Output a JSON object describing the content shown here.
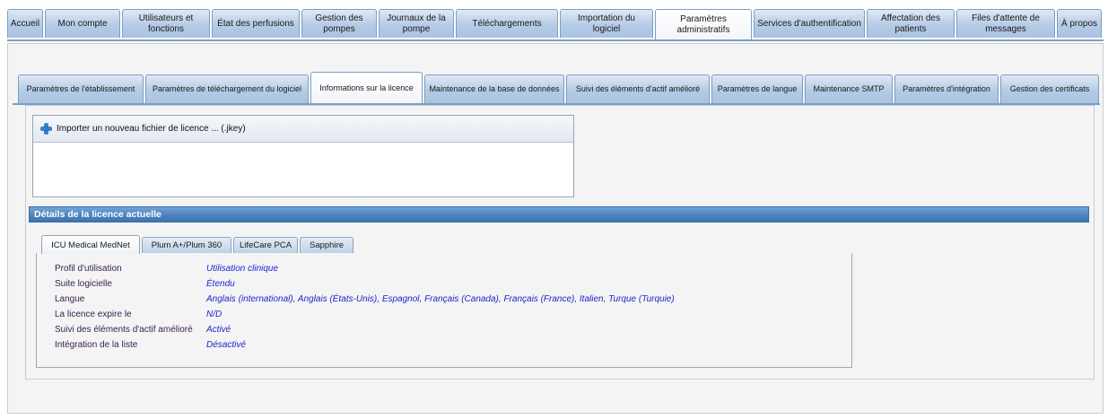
{
  "main_nav": {
    "tabs": [
      {
        "label": "Accueil"
      },
      {
        "label": "Mon compte"
      },
      {
        "label": "Utilisateurs et fonctions"
      },
      {
        "label": "État des perfusions"
      },
      {
        "label": "Gestion des pompes"
      },
      {
        "label": "Journaux de la pompe"
      },
      {
        "label": "Téléchargements"
      },
      {
        "label": "Importation du logiciel"
      },
      {
        "label": "Paramètres administratifs",
        "active": true
      },
      {
        "label": "Services d'authentification"
      },
      {
        "label": "Affectation des patients"
      },
      {
        "label": "Files d'attente de messages"
      },
      {
        "label": "À propos"
      }
    ]
  },
  "sub_nav": {
    "tabs": [
      {
        "label": "Paramètres de l'établissement"
      },
      {
        "label": "Paramètres de téléchargement du logiciel"
      },
      {
        "label": "Informations sur la licence",
        "active": true
      },
      {
        "label": "Maintenance de la base de données"
      },
      {
        "label": "Suivi des éléments d'actif amélioré"
      },
      {
        "label": "Paramètres de langue"
      },
      {
        "label": "Maintenance SMTP"
      },
      {
        "label": "Paramètres d'intégration"
      },
      {
        "label": "Gestion des certificats"
      }
    ]
  },
  "import": {
    "button_label": "Importer un nouveau fichier de licence  ... (.jkey)",
    "icon": "plus-icon"
  },
  "details": {
    "header": "Détails de la licence actuelle",
    "product_tabs": [
      {
        "label": "ICU Medical MedNet",
        "active": true
      },
      {
        "label": "Plum A+/Plum 360"
      },
      {
        "label": "LifeCare PCA"
      },
      {
        "label": "Sapphire"
      }
    ],
    "rows": [
      {
        "label": "Profil d'utilisation",
        "value": "Utilisation clinique"
      },
      {
        "label": "Suite logicielle",
        "value": "Étendu"
      },
      {
        "label": "Langue",
        "value": "Anglais (international), Anglais (États-Unis), Espagnol, Français (Canada), Français (France), Italien, Turque (Turquie)"
      },
      {
        "label": "La licence expire le",
        "value": "N/D"
      },
      {
        "label": "Suivi des éléments d'actif amélioré",
        "value": "Activé"
      },
      {
        "label": "Intégration de la liste",
        "value": "Désactivé"
      }
    ]
  },
  "colors": {
    "tab_gradient_top": "#dfe9f5",
    "tab_gradient_bottom": "#a9c3e2",
    "header_blue": "#4f86c2",
    "value_text": "#2222cc",
    "label_text": "#3a2050"
  }
}
